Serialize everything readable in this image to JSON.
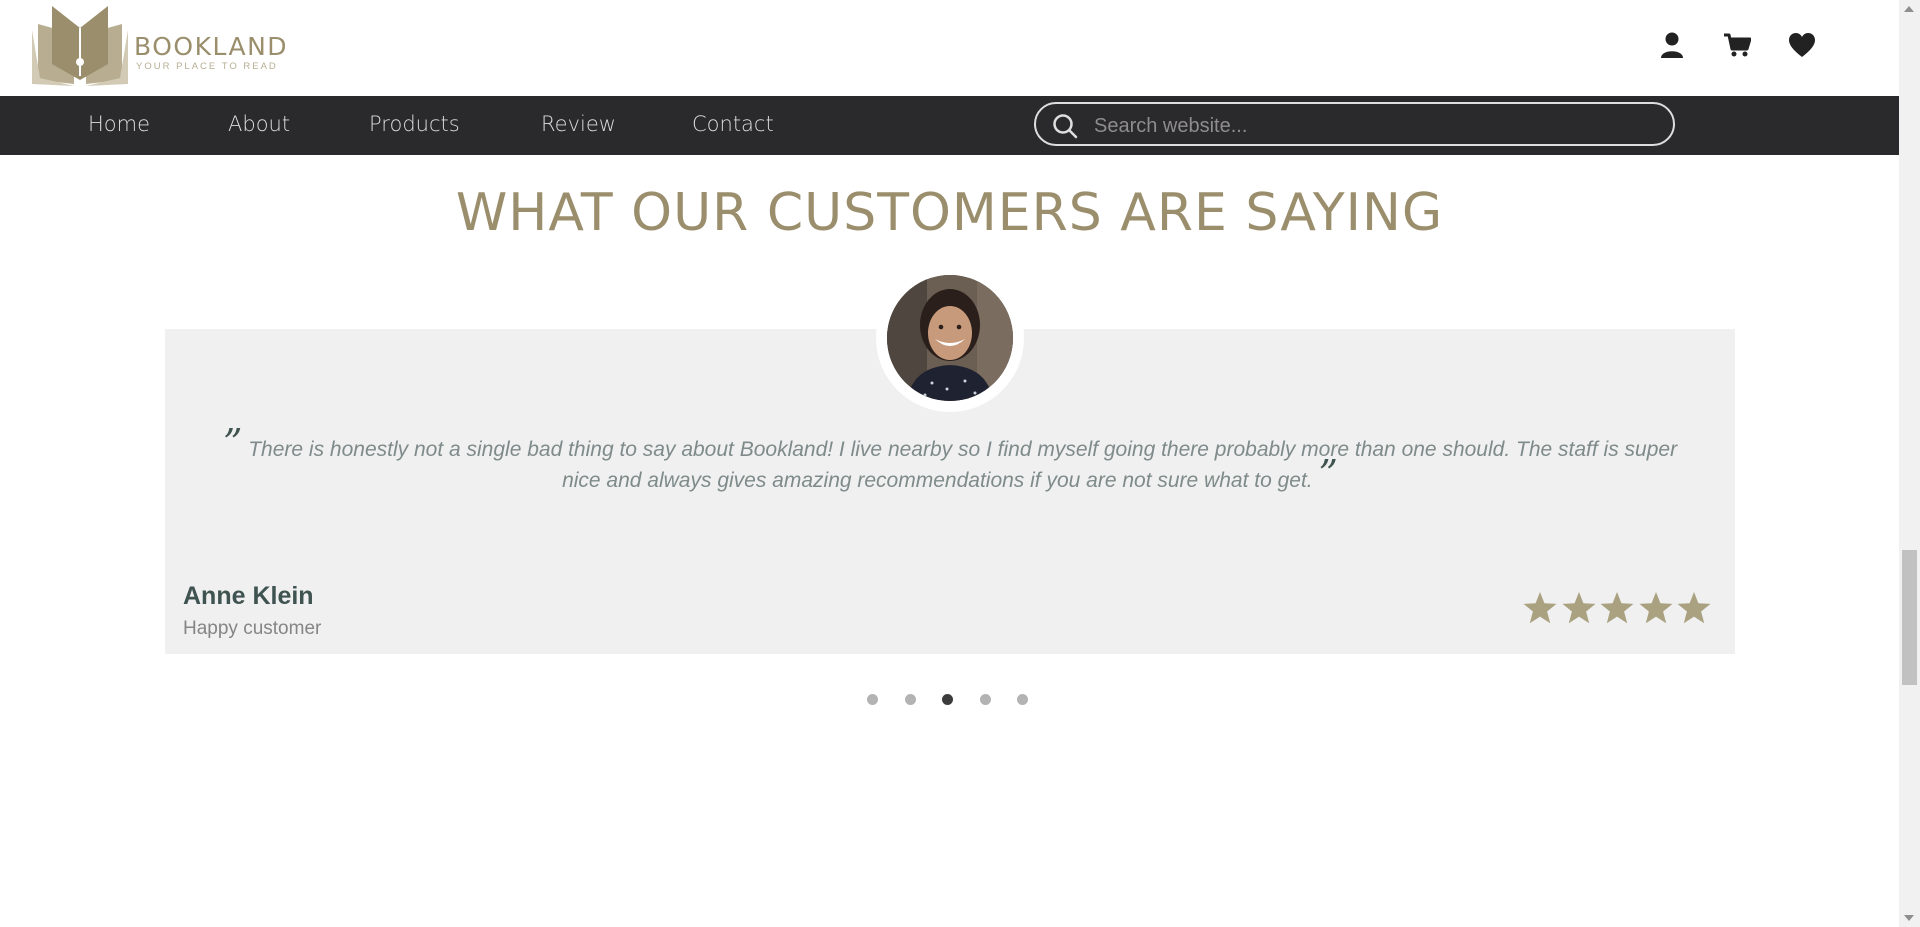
{
  "brand": {
    "name": "BOOKLAND",
    "tagline": "YOUR PLACE TO READ",
    "color": "#9a8e6c"
  },
  "header_icons": [
    "user-icon",
    "cart-icon",
    "heart-icon"
  ],
  "nav": {
    "items": [
      {
        "label": "Home"
      },
      {
        "label": "About"
      },
      {
        "label": "Products"
      },
      {
        "label": "Review"
      },
      {
        "label": "Contact"
      }
    ],
    "search_placeholder": "Search website..."
  },
  "reviews": {
    "title": "WHAT OUR CUSTOMERS ARE SAYING",
    "quote": "There is honestly not a single bad thing to say about Bookland! I live nearby so I find myself going there probably more than one should. The staff is super nice and always gives amazing recommendations if you are not sure what to get.",
    "open_mark": "”",
    "close_mark": "”",
    "reviewer_name": "Anne Klein",
    "reviewer_role": "Happy customer",
    "rating": 5,
    "rating_max": 5,
    "slide_count": 5,
    "active_slide": 3
  },
  "colors": {
    "navbar_bg": "#2a292b",
    "accent": "#9a8e6c",
    "card_bg": "#eff0ef",
    "name_color": "#3f5350"
  }
}
